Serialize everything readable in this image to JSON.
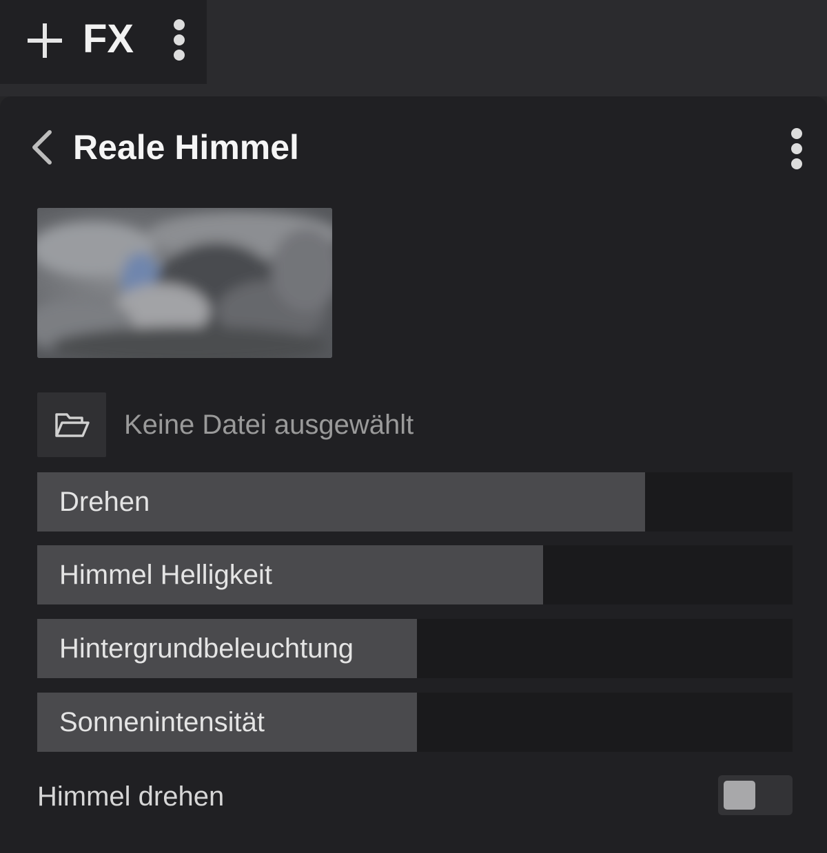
{
  "toolbar": {
    "add_icon": "plus-icon",
    "fx_label": "FX",
    "menu_icon": "kebab-menu-icon"
  },
  "panel": {
    "back_icon": "chevron-left-icon",
    "title": "Reale Himmel",
    "menu_icon": "kebab-menu-icon",
    "preview_image": "cloudy-sky-thumbnail",
    "file_picker": {
      "icon": "folder-open-icon",
      "status_text": "Keine Datei ausgewählt"
    },
    "sliders": [
      {
        "label": "Drehen",
        "value_fraction": 0.805
      },
      {
        "label": "Himmel Helligkeit",
        "value_fraction": 0.67
      },
      {
        "label": "Hintergrundbeleuchtung",
        "value_fraction": 0.503
      },
      {
        "label": "Sonnenintensität",
        "value_fraction": 0.503
      }
    ],
    "toggle": {
      "label": "Himmel drehen",
      "on": false
    }
  },
  "colors": {
    "panel_bg": "#202023",
    "topbar_bg": "#2b2b2e",
    "slider_fill": "#4a4a4d",
    "slider_track": "#1a1a1c"
  }
}
